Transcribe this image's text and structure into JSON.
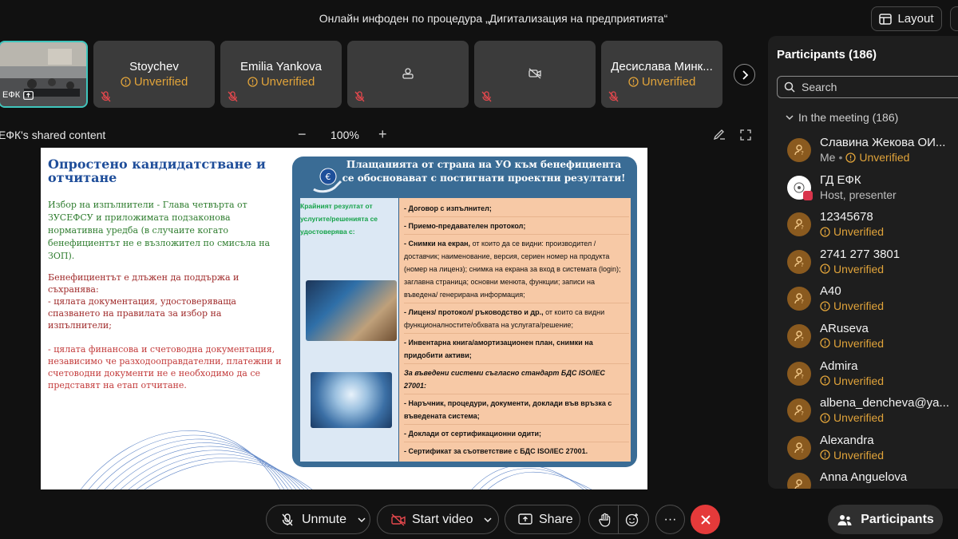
{
  "header": {
    "meeting_title": "Онлайн инфоден по процедура „Дигитализация на предприятията“",
    "layout_label": "Layout"
  },
  "tiles": [
    {
      "name": "",
      "tag": "ЕФК",
      "self": true
    },
    {
      "name": "Stoychev",
      "status": "Unverified"
    },
    {
      "name": "Emilia Yankova",
      "status": "Unverified"
    },
    {
      "name": "",
      "status": ""
    },
    {
      "name": "",
      "status": ""
    },
    {
      "name": "Десислава Минк...",
      "status": "Unverified"
    }
  ],
  "share": {
    "label": "ЕФК's shared content",
    "zoom": "100%",
    "zoom_minus": "−",
    "zoom_plus": "+"
  },
  "slide": {
    "title": "Опростено кандидатстване и отчитане",
    "green_text": "Избор на изпълнители - Глава четвърта от ЗУСЕФСУ и приложимата подзаконова нормативна уредба (в случаите когато бенефициентът не е възложител по смисъла на ЗОП).",
    "red1_lead": "Бенефициентът е длъжен да поддържа и съхранява:",
    "red1_item": "- цялата документация, удостоверяваща спазването на правилата за избор на изпълнители;",
    "red2_text": "- цялата финансова и счетоводна документация, независимо че разходооправдателни, платежни и счетоводни документи не е необходимо да се представят на етап отчитане.",
    "panel_heading": "Плащанията от страна на УО към бенефициента се обосновават с постигнати проектни резултати!",
    "panel_left_text": "Крайният резултат от услугите/решенията се удостоверява с:",
    "items": {
      "i1": "- Договор с изпълнител;",
      "i2": "- Приемо-предавателен протокол;",
      "i3_bold": "- Снимки на екран,",
      "i3_rest": " от които да се видни: производител / доставчик; наименование, версия, сериен номер на продукта (номер на лиценз); снимка на екрана за вход в системата (login); заглавна страница; основни менюта, функции; записи на въведена/ генерирана информация;",
      "i4_bold": "- Лиценз/ протокол/ ръководство и др.,",
      "i4_rest": " от които са видни функционалностите/обхвата на услугата/решение;",
      "i5": "- Инвентарна книга/амортизационен план, снимки на придобити активи;",
      "i6": "За въведени системи съгласно стандарт БДС ISO/IEC 27001:",
      "i7": "- Наръчник, процедури, документи, доклади във връзка с въведената система;",
      "i8": "- Доклади от сертификационни одити;",
      "i9": "- Сертификат за съответствие с БДС ISO/IEC 27001."
    }
  },
  "sidebar": {
    "title": "Participants (186)",
    "search_placeholder": "Search",
    "group_label": "In the meeting (186)",
    "participants": [
      {
        "name": "Славина Жекова ОИ...",
        "sub_prefix": "Me",
        "status": "Unverified"
      },
      {
        "name": "ГД ЕФК",
        "role": "Host, presenter"
      },
      {
        "name": "12345678",
        "status": "Unverified"
      },
      {
        "name": "2741 277 3801",
        "status": "Unverified"
      },
      {
        "name": "A40",
        "status": "Unverified"
      },
      {
        "name": "ARuseva",
        "status": "Unverified"
      },
      {
        "name": "Admira",
        "status": "Unverified"
      },
      {
        "name": "albena_dencheva@ya...",
        "status": "Unverified"
      },
      {
        "name": "Alexandra",
        "status": "Unverified"
      },
      {
        "name": "Anna Anguelova",
        "status": ""
      }
    ]
  },
  "controls": {
    "unmute": "Unmute",
    "start_video": "Start video",
    "share": "Share",
    "more": "···",
    "participants": "Participants"
  },
  "colors": {
    "accent_teal": "#3fc6bd",
    "unverified": "#e0a33a",
    "end_red": "#e53a3a",
    "background": "#111111"
  }
}
